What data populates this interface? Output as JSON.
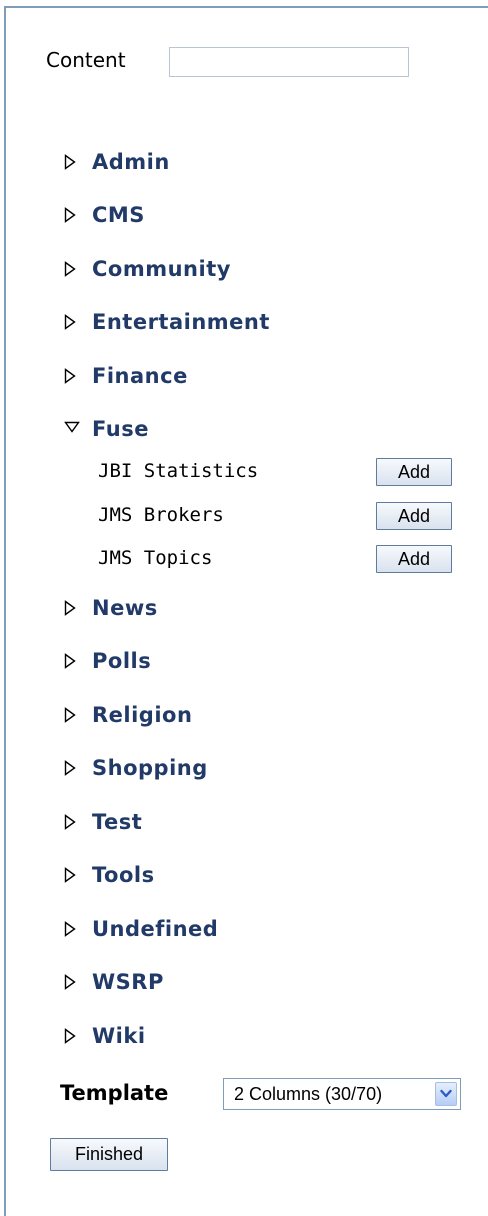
{
  "search": {
    "label": "Content",
    "value": "",
    "placeholder": ""
  },
  "categories": [
    {
      "name": "Admin",
      "state": "collapsed"
    },
    {
      "name": "CMS",
      "state": "collapsed"
    },
    {
      "name": "Community",
      "state": "collapsed"
    },
    {
      "name": "Entertainment",
      "state": "collapsed"
    },
    {
      "name": "Finance",
      "state": "collapsed"
    },
    {
      "name": "Fuse",
      "state": "expanded",
      "items": [
        {
          "label": "JBI Statistics",
          "button": "Add"
        },
        {
          "label": "JMS Brokers",
          "button": "Add"
        },
        {
          "label": "JMS Topics",
          "button": "Add"
        }
      ]
    },
    {
      "name": "News",
      "state": "collapsed"
    },
    {
      "name": "Polls",
      "state": "collapsed"
    },
    {
      "name": "Religion",
      "state": "collapsed"
    },
    {
      "name": "Shopping",
      "state": "collapsed"
    },
    {
      "name": "Test",
      "state": "collapsed"
    },
    {
      "name": "Tools",
      "state": "collapsed"
    },
    {
      "name": "Undefined",
      "state": "collapsed"
    },
    {
      "name": "WSRP",
      "state": "collapsed"
    },
    {
      "name": "Wiki",
      "state": "collapsed"
    }
  ],
  "template": {
    "label": "Template",
    "selected": "2 Columns (30/70)"
  },
  "finished_label": "Finished",
  "icons": {
    "collapsed": "triangle-right-icon",
    "expanded": "triangle-down-icon",
    "dropdown": "chevron-down-icon"
  },
  "colors": {
    "category_text": "#213a67",
    "panel_border": "#7f9db9",
    "dropdown_accent": "#2b5bc7"
  }
}
